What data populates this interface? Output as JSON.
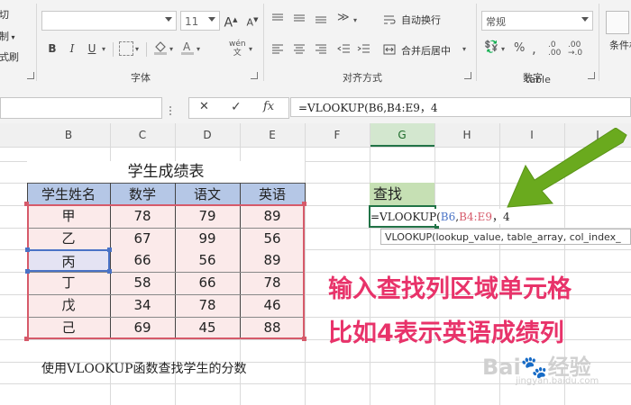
{
  "ribbon": {
    "clipboard": {
      "cut": "剪切",
      "copy": "复制",
      "format_painter": "格式刷"
    },
    "font": {
      "font_name": "",
      "font_size": "11",
      "group_label": "字体",
      "bold": "B",
      "italic": "I",
      "underline": "U",
      "phonetic": "wén"
    },
    "alignment": {
      "wrap_text": "自动换行",
      "merge_center": "合并后居中",
      "group_label": "对齐方式"
    },
    "number": {
      "format": "常规",
      "group_label": "数字"
    },
    "styles": {
      "conditional_format": "条件格",
      "table_format": "table"
    },
    "fill_color": "#c0c0c0"
  },
  "formula_bar": {
    "name_box": "",
    "cancel_icon": "✕",
    "enter_icon": "✓",
    "fx": "fx",
    "formula": "=VLOOKUP(B6,B4:E9，4"
  },
  "columns": [
    "B",
    "C",
    "D",
    "E",
    "F",
    "G",
    "H",
    "I",
    "J"
  ],
  "sheet": {
    "title": "学生成绩表",
    "headers": [
      "学生姓名",
      "数学",
      "语文",
      "英语"
    ],
    "rows": [
      [
        "甲",
        "78",
        "79",
        "89"
      ],
      [
        "乙",
        "67",
        "99",
        "56"
      ],
      [
        "丙",
        "66",
        "56",
        "89"
      ],
      [
        "丁",
        "58",
        "66",
        "78"
      ],
      [
        "戊",
        "34",
        "78",
        "46"
      ],
      [
        "己",
        "69",
        "45",
        "88"
      ]
    ],
    "note": "使用VLOOKUP函数查找学生的分数",
    "lookup_label": "查找",
    "active_cell_formula": {
      "part1": "=VLOOKUP(",
      "part2": "B6",
      "part3": ",",
      "part4": "B4:E9",
      "part5": "，4"
    },
    "tooltip": "VLOOKUP(lookup_value, table_array, col_index_"
  },
  "annotations": {
    "line1": "输入查找列区域单元格",
    "line2": "比如4表示英语成绩列",
    "color": "#e8336a",
    "arrow_color": "#6aaa1e"
  },
  "watermark": {
    "text": "Bai🐾经验",
    "sub": "jingyan.baidu.com"
  },
  "colors": {
    "header_fill": "#b5c7e6",
    "data_fill": "#fbeaea",
    "lookup_fill": "#c6e0b4",
    "range_border": "#d65a6a"
  }
}
